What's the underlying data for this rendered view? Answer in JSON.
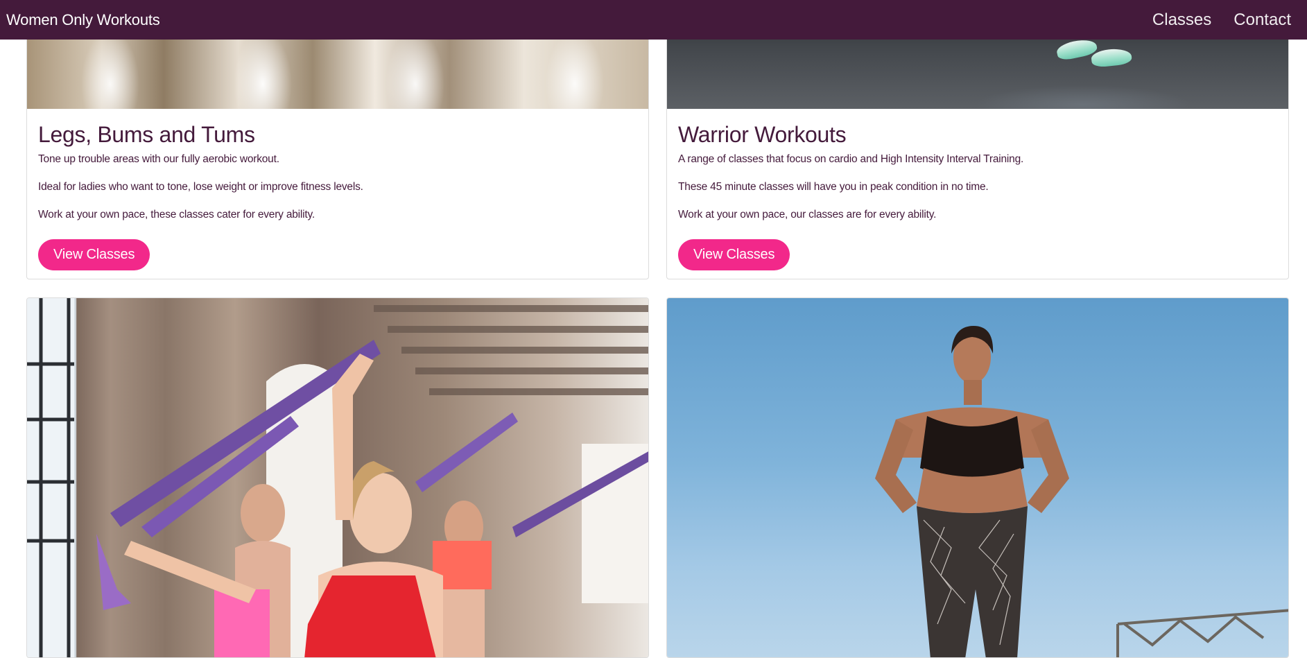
{
  "navbar": {
    "brand": "Women Only Workouts",
    "links": [
      {
        "label": "Classes"
      },
      {
        "label": "Contact"
      }
    ]
  },
  "cards": [
    {
      "title": "Legs, Bums and Tums",
      "paragraphs": [
        "Tone up trouble areas with our fully aerobic workout.",
        "Ideal for ladies who want to tone, lose weight or improve fitness levels.",
        "Work at your own pace, these classes cater for every ability."
      ],
      "button": "View Classes"
    },
    {
      "title": "Warrior Workouts",
      "paragraphs": [
        "A range of classes that focus on cardio and High Intensity Interval Training.",
        "These 45 minute classes will have you in peak condition in no time.",
        "Work at your own pace, our classes are for every ability."
      ],
      "button": "View Classes"
    }
  ],
  "colors": {
    "navbar_bg": "#441a3b",
    "accent": "#f2288a",
    "text": "#441a3b"
  }
}
